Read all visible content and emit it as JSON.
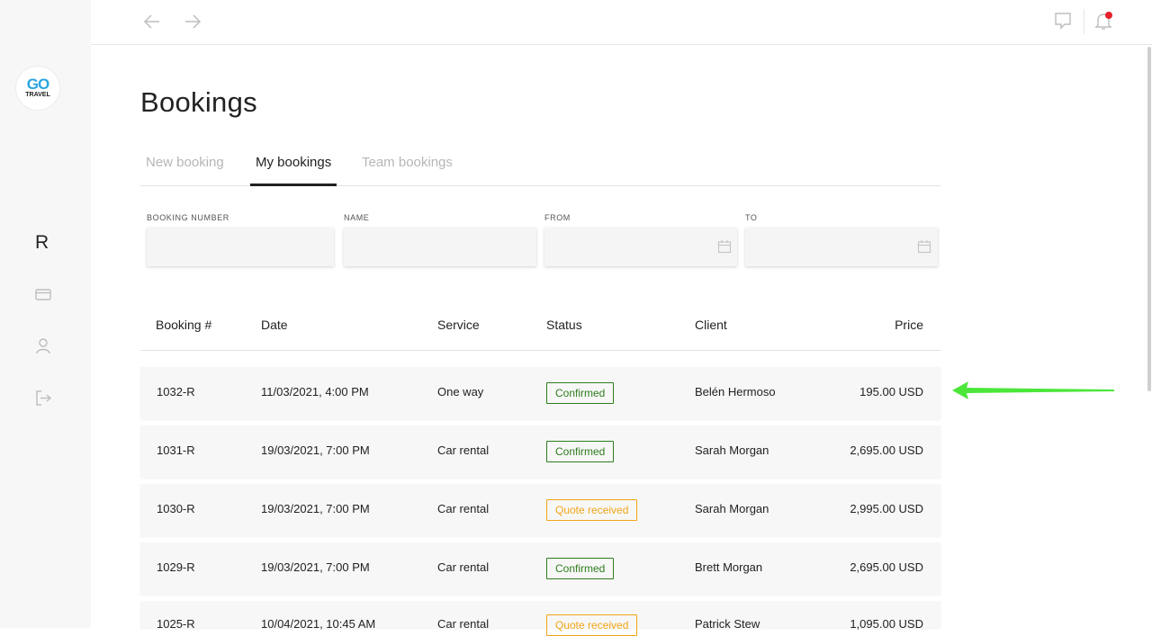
{
  "brand": {
    "logo_top": "GO",
    "logo_bottom": "TRAVEL"
  },
  "sidebar": {
    "user_initial": "R",
    "items": [
      {
        "icon": "credit-card-icon"
      },
      {
        "icon": "user-icon"
      },
      {
        "icon": "logout-icon"
      }
    ]
  },
  "topbar": {
    "back_icon": "arrow-left-icon",
    "forward_icon": "arrow-right-icon",
    "chat_icon": "chat-icon",
    "notification_icon": "bell-icon",
    "notification_dot_color": "#e6202a"
  },
  "page": {
    "title": "Bookings"
  },
  "tabs": [
    {
      "label": "New booking",
      "active": false
    },
    {
      "label": "My bookings",
      "active": true
    },
    {
      "label": "Team bookings",
      "active": false
    }
  ],
  "filters": {
    "booking_number": {
      "label": "BOOKING NUMBER",
      "value": ""
    },
    "name": {
      "label": "NAME",
      "value": ""
    },
    "from": {
      "label": "FROM",
      "value": ""
    },
    "to": {
      "label": "TO",
      "value": ""
    }
  },
  "table": {
    "columns": [
      "Booking #",
      "Date",
      "Service",
      "Status",
      "Client",
      "Price"
    ],
    "rows": [
      {
        "booking": "1032-R",
        "date": "11/03/2021, 4:00 PM",
        "service": "One way",
        "status": "Confirmed",
        "client": "Belén Hermoso",
        "price": "195.00 USD"
      },
      {
        "booking": "1031-R",
        "date": "19/03/2021, 7:00 PM",
        "service": "Car rental",
        "status": "Confirmed",
        "client": "Sarah Morgan",
        "price": "2,695.00 USD"
      },
      {
        "booking": "1030-R",
        "date": "19/03/2021, 7:00 PM",
        "service": "Car rental",
        "status": "Quote received",
        "client": "Sarah Morgan",
        "price": "2,995.00 USD"
      },
      {
        "booking": "1029-R",
        "date": "19/03/2021, 7:00 PM",
        "service": "Car rental",
        "status": "Confirmed",
        "client": "Brett Morgan",
        "price": "2,695.00 USD"
      },
      {
        "booking": "1025-R",
        "date": "10/04/2021, 10:45 AM",
        "service": "Car rental",
        "status": "Quote received",
        "client": "Patrick Stew",
        "price": "1,095.00 USD"
      }
    ]
  },
  "colors": {
    "confirmed": "#2e7d1e",
    "quote_received": "#f2a516",
    "annotation_arrow": "#4ce63a"
  }
}
